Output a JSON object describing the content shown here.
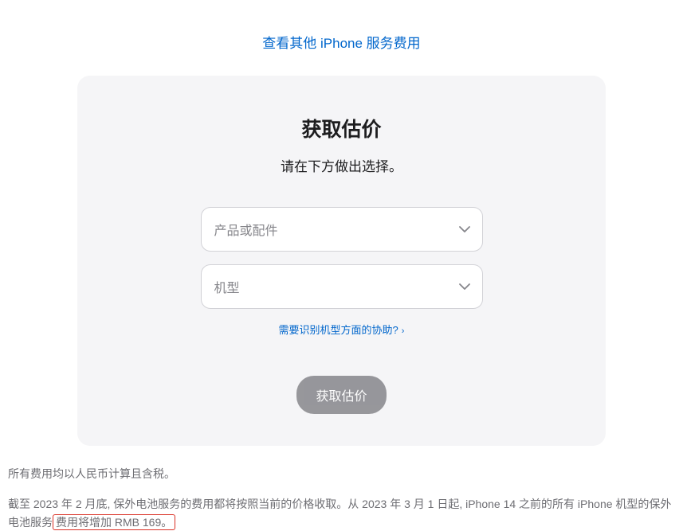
{
  "topLink": {
    "label": "查看其他 iPhone 服务费用"
  },
  "card": {
    "title": "获取估价",
    "subtitle": "请在下方做出选择。",
    "select1": {
      "placeholder": "产品或配件"
    },
    "select2": {
      "placeholder": "机型"
    },
    "helpLink": {
      "label": "需要识别机型方面的协助?"
    },
    "submit": {
      "label": "获取估价"
    }
  },
  "footer": {
    "line1": "所有费用均以人民币计算且含税。",
    "line2_before": "截至 2023 年 2 月底, 保外电池服务的费用都将按照当前的价格收取。从 2023 年 3 月 1 日起, iPhone 14 之前的所有 iPhone 机型的保外电池服务",
    "line2_highlight": "费用将增加 RMB 169。"
  }
}
